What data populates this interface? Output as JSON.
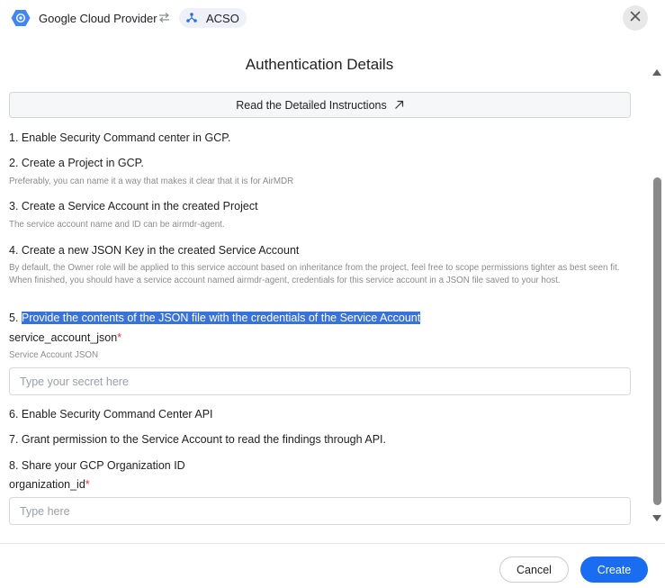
{
  "header": {
    "provider_name": "Google Cloud Provider",
    "target_name": "ACSO",
    "provider_icon": "gcp-hexagon-icon",
    "swap_icon": "swap-arrows-icon",
    "target_icon": "network-nodes-icon",
    "close_icon": "close-icon"
  },
  "dialog": {
    "title": "Authentication Details",
    "instructions_button_label": "Read the Detailed Instructions",
    "instructions_button_icon": "external-link-icon"
  },
  "steps": [
    {
      "text": "1. Enable Security Command center in GCP.",
      "hint": ""
    },
    {
      "text": "2. Create a Project in GCP.",
      "hint": "Preferably, you can name it a way that makes it clear that it is for AirMDR"
    },
    {
      "text": "3. Create a Service Account in the created Project",
      "hint": "The service account name and ID can be airmdr-agent."
    },
    {
      "text": "4. Create a new JSON Key in the created Service Account",
      "hint": "By default, the Owner role will be applied to this service account based on inheritance from the project, feel free to scope permissions tighter as best seen fit. When finished, you should have a service account named airmdr-agent, credentials for this service account in a JSON file saved to your host."
    },
    {
      "prefix": "5. ",
      "text": "Provide the contents of the JSON file with the credentials of the Service Account"
    },
    {
      "text": "6. Enable Security Command Center API"
    },
    {
      "text": "7. Grant permission to the Service Account to read the findings through API."
    },
    {
      "text": "8. Share your GCP Organization ID"
    }
  ],
  "fields": {
    "service_account_json": {
      "label": "service_account_json",
      "required_mark": "*",
      "description": "Service Account JSON",
      "placeholder": "Type your secret here",
      "value": ""
    },
    "organization_id": {
      "label": "organization_id",
      "required_mark": "*",
      "placeholder": "Type here",
      "value": ""
    }
  },
  "footer": {
    "cancel_label": "Cancel",
    "create_label": "Create"
  },
  "colors": {
    "primary": "#1a6cf0",
    "selection_highlight": "#3a73d8",
    "required": "#d9363e"
  }
}
